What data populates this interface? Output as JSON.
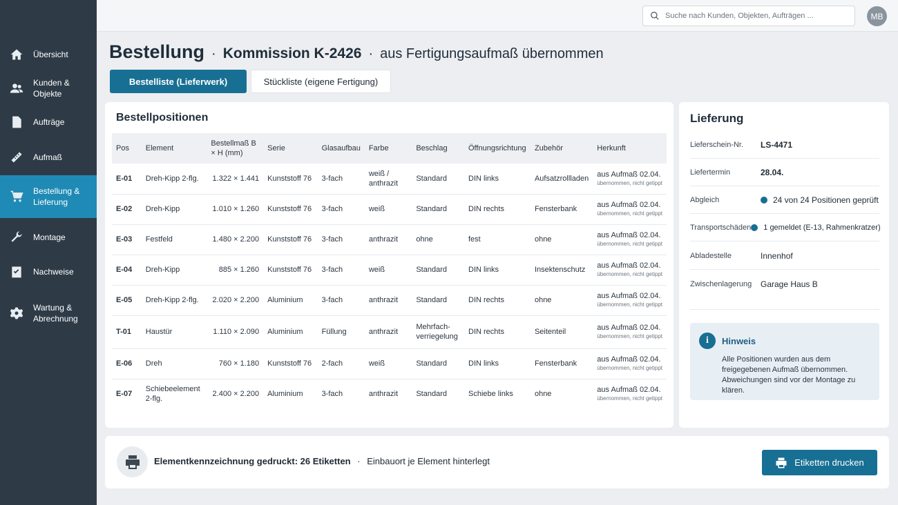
{
  "sidebar": {
    "items": [
      {
        "label": "Übersicht",
        "icon": "home-icon"
      },
      {
        "label": "Kunden & Objekte",
        "icon": "people-icon"
      },
      {
        "label": "Aufträge",
        "icon": "document-icon"
      },
      {
        "label": "Aufmaß",
        "icon": "ruler-icon"
      },
      {
        "label": "Bestellung & Lieferung",
        "icon": "cart-icon",
        "active": true
      },
      {
        "label": "Montage",
        "icon": "wrench-icon"
      },
      {
        "label": "Nachweise",
        "icon": "checklist-icon"
      },
      {
        "label": "Wartung & Abrechnung",
        "icon": "gear-icon"
      }
    ]
  },
  "topbar": {
    "search_placeholder": "Suche nach Kunden, Objekten, Aufträgen ...",
    "avatar_initials": "MB"
  },
  "page": {
    "title": "Bestellung",
    "separator": "·",
    "commission": "Kommission K-2426",
    "source": "aus Fertigungsaufmaß übernommen"
  },
  "tabs": [
    {
      "label": "Bestelliste (Lieferwerk)",
      "active": true
    },
    {
      "label": "Stückliste (eigene Fertigung)",
      "active": false
    }
  ],
  "positions": {
    "title": "Bestellpositionen",
    "columns": [
      "Pos",
      "Element",
      "Bestellmaß B × H (mm)",
      "Serie",
      "Glasaufbau",
      "Farbe",
      "Beschlag",
      "Öffnungsrichtung",
      "Zubehör",
      "Herkunft"
    ],
    "rows": [
      {
        "pos": "E-01",
        "element": "Dreh-Kipp 2-flg.",
        "mass": "1.322 × 1.441",
        "serie": "Kunststoff 76",
        "glas": "3-fach",
        "farbe": "weiß / anthrazit",
        "beschlag": "Standard",
        "richtung": "DIN links",
        "zubehoer": "Aufsatzrollladen",
        "herkunft": "aus Aufmaß 02.04.",
        "herkunft_sub": "übernommen, nicht getippt"
      },
      {
        "pos": "E-02",
        "element": "Dreh-Kipp",
        "mass": "1.010 × 1.260",
        "serie": "Kunststoff 76",
        "glas": "3-fach",
        "farbe": "weiß",
        "beschlag": "Standard",
        "richtung": "DIN rechts",
        "zubehoer": "Fensterbank",
        "herkunft": "aus Aufmaß 02.04.",
        "herkunft_sub": "übernommen, nicht getippt"
      },
      {
        "pos": "E-03",
        "element": "Festfeld",
        "mass": "1.480 × 2.200",
        "serie": "Kunststoff 76",
        "glas": "3-fach",
        "farbe": "anthrazit",
        "beschlag": "ohne",
        "richtung": "fest",
        "zubehoer": "ohne",
        "herkunft": "aus Aufmaß 02.04.",
        "herkunft_sub": "übernommen, nicht getippt"
      },
      {
        "pos": "E-04",
        "element": "Dreh-Kipp",
        "mass": "885 × 1.260",
        "serie": "Kunststoff 76",
        "glas": "3-fach",
        "farbe": "weiß",
        "beschlag": "Standard",
        "richtung": "DIN links",
        "zubehoer": "Insektenschutz",
        "herkunft": "aus Aufmaß 02.04.",
        "herkunft_sub": "übernommen, nicht getippt"
      },
      {
        "pos": "E-05",
        "element": "Dreh-Kipp 2-flg.",
        "mass": "2.020 × 2.200",
        "serie": "Aluminium",
        "glas": "3-fach",
        "farbe": "anthrazit",
        "beschlag": "Standard",
        "richtung": "DIN rechts",
        "zubehoer": "ohne",
        "herkunft": "aus Aufmaß 02.04.",
        "herkunft_sub": "übernommen, nicht getippt"
      },
      {
        "pos": "T-01",
        "element": "Haustür",
        "mass": "1.110 × 2.090",
        "serie": "Aluminium",
        "glas": "Füllung",
        "farbe": "anthrazit",
        "beschlag": "Mehrfach-verriegelung",
        "richtung": "DIN rechts",
        "zubehoer": "Seitenteil",
        "herkunft": "aus Aufmaß 02.04.",
        "herkunft_sub": "übernommen, nicht getippt"
      },
      {
        "pos": "E-06",
        "element": "Dreh",
        "mass": "760 × 1.180",
        "serie": "Kunststoff 76",
        "glas": "2-fach",
        "farbe": "weiß",
        "beschlag": "Standard",
        "richtung": "DIN links",
        "zubehoer": "Fensterbank",
        "herkunft": "aus Aufmaß 02.04.",
        "herkunft_sub": "übernommen, nicht getippt"
      },
      {
        "pos": "E-07",
        "element": "Schiebeelement 2-flg.",
        "mass": "2.400 × 2.200",
        "serie": "Aluminium",
        "glas": "3-fach",
        "farbe": "anthrazit",
        "beschlag": "Standard",
        "richtung": "Schiebe links",
        "zubehoer": "ohne",
        "herkunft": "aus Aufmaß 02.04.",
        "herkunft_sub": "übernommen, nicht getippt"
      }
    ]
  },
  "delivery": {
    "title": "Lieferung",
    "rows": [
      {
        "label": "Lieferschein-Nr.",
        "value": "LS-4471",
        "strong": true
      },
      {
        "label": "Liefertermin",
        "value": "28.04.",
        "strong": true
      },
      {
        "label": "Abgleich",
        "value": "24 von 24 Positionen geprüft",
        "dot": true
      },
      {
        "label": "Transportschäden",
        "value": "1 gemeldet (E-13, Rahmenkratzer)",
        "dot": true
      },
      {
        "label": "Abladestelle",
        "value": "Innenhof"
      },
      {
        "label": "Zwischenlagerung",
        "value": "Garage Haus B"
      }
    ],
    "hint": {
      "title": "Hinweis",
      "text": "Alle Positionen wurden aus dem freigegebenen Aufmaß übernommen. Abweichungen sind vor der Montage zu klären."
    }
  },
  "bottom": {
    "label_strong": "Elementkennzeichnung gedruckt: 26 Etiketten",
    "separator": "·",
    "label_rest": "Einbauort je Element hinterlegt",
    "button": "Etiketten drucken"
  },
  "colors": {
    "sidebar_bg": "#2e3b47",
    "accent": "#176f93",
    "active_nav": "#1f8ab5"
  }
}
